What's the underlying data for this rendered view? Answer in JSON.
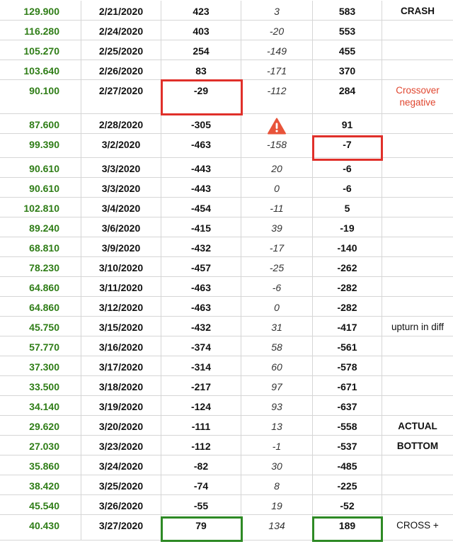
{
  "rows": [
    {
      "value": "129.900",
      "date": "2/21/2020",
      "a": "423",
      "diff": "3",
      "b": "583",
      "note": "CRASH"
    },
    {
      "value": "116.280",
      "date": "2/24/2020",
      "a": "403",
      "diff": "-20",
      "b": "553",
      "note": ""
    },
    {
      "value": "105.270",
      "date": "2/25/2020",
      "a": "254",
      "diff": "-149",
      "b": "455",
      "note": ""
    },
    {
      "value": "103.640",
      "date": "2/26/2020",
      "a": "83",
      "diff": "-171",
      "b": "370",
      "note": ""
    },
    {
      "value": "90.100",
      "date": "2/27/2020",
      "a": "-29",
      "diff": "-112",
      "b": "284",
      "note": "Crossover negative"
    },
    {
      "value": "87.600",
      "date": "2/28/2020",
      "a": "-305",
      "diff": "",
      "b": "91",
      "note": ""
    },
    {
      "value": "99.390",
      "date": "3/2/2020",
      "a": "-463",
      "diff": "-158",
      "b": "-7",
      "note": ""
    },
    {
      "value": "90.610",
      "date": "3/3/2020",
      "a": "-443",
      "diff": "20",
      "b": "-6",
      "note": ""
    },
    {
      "value": "90.610",
      "date": "3/3/2020",
      "a": "-443",
      "diff": "0",
      "b": "-6",
      "note": ""
    },
    {
      "value": "102.810",
      "date": "3/4/2020",
      "a": "-454",
      "diff": "-11",
      "b": "5",
      "note": ""
    },
    {
      "value": "89.240",
      "date": "3/6/2020",
      "a": "-415",
      "diff": "39",
      "b": "-19",
      "note": ""
    },
    {
      "value": "68.810",
      "date": "3/9/2020",
      "a": "-432",
      "diff": "-17",
      "b": "-140",
      "note": ""
    },
    {
      "value": "78.230",
      "date": "3/10/2020",
      "a": "-457",
      "diff": "-25",
      "b": "-262",
      "note": ""
    },
    {
      "value": "64.860",
      "date": "3/11/2020",
      "a": "-463",
      "diff": "-6",
      "b": "-282",
      "note": ""
    },
    {
      "value": "64.860",
      "date": "3/12/2020",
      "a": "-463",
      "diff": "0",
      "b": "-282",
      "note": ""
    },
    {
      "value": "45.750",
      "date": "3/15/2020",
      "a": "-432",
      "diff": "31",
      "b": "-417",
      "note": "upturn in diff"
    },
    {
      "value": "57.770",
      "date": "3/16/2020",
      "a": "-374",
      "diff": "58",
      "b": "-561",
      "note": ""
    },
    {
      "value": "37.300",
      "date": "3/17/2020",
      "a": "-314",
      "diff": "60",
      "b": "-578",
      "note": ""
    },
    {
      "value": "33.500",
      "date": "3/18/2020",
      "a": "-217",
      "diff": "97",
      "b": "-671",
      "note": ""
    },
    {
      "value": "34.140",
      "date": "3/19/2020",
      "a": "-124",
      "diff": "93",
      "b": "-637",
      "note": ""
    },
    {
      "value": "29.620",
      "date": "3/20/2020",
      "a": "-111",
      "diff": "13",
      "b": "-558",
      "note": "ACTUAL"
    },
    {
      "value": "27.030",
      "date": "3/23/2020",
      "a": "-112",
      "diff": "-1",
      "b": "-537",
      "note": "BOTTOM"
    },
    {
      "value": "35.860",
      "date": "3/24/2020",
      "a": "-82",
      "diff": "30",
      "b": "-485",
      "note": ""
    },
    {
      "value": "38.420",
      "date": "3/25/2020",
      "a": "-74",
      "diff": "8",
      "b": "-225",
      "note": ""
    },
    {
      "value": "45.540",
      "date": "3/26/2020",
      "a": "-55",
      "diff": "19",
      "b": "-52",
      "note": ""
    },
    {
      "value": "40.430",
      "date": "3/27/2020",
      "a": "79",
      "diff": "134",
      "b": "189",
      "note": "CROSS +"
    }
  ],
  "icons": {
    "warning": "warning-triangle-icon"
  },
  "colors": {
    "value_text": "#2f7d17",
    "highlight_red": "#e0302a",
    "highlight_green": "#2e8a25",
    "note_red": "#e0462f"
  }
}
